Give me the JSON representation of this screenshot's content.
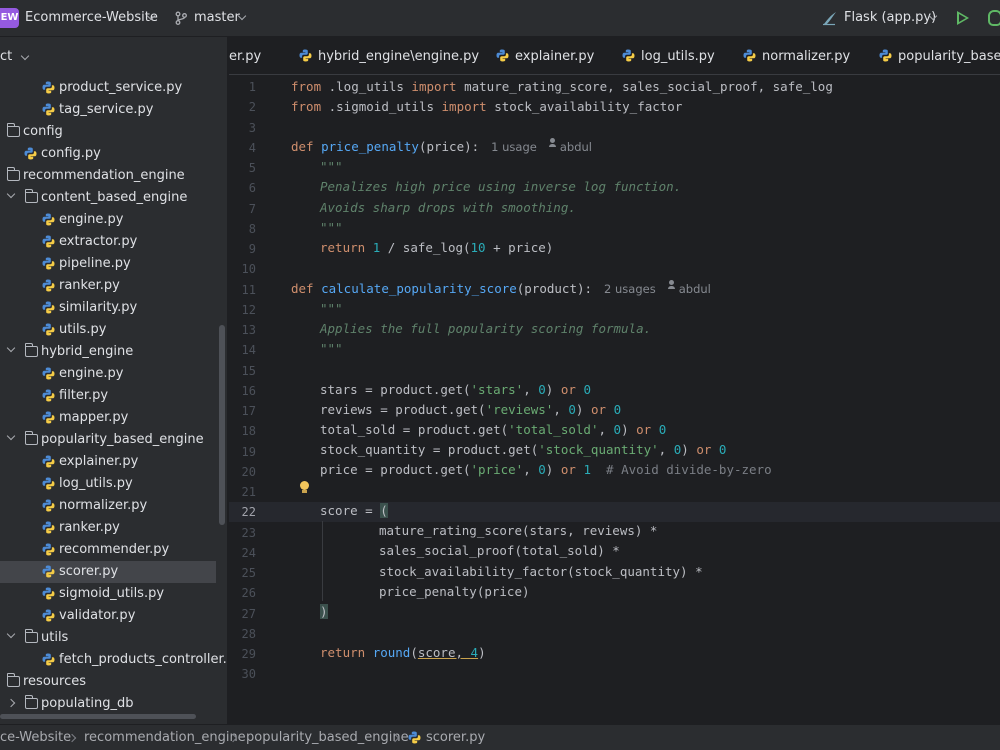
{
  "topbar": {
    "project_badge": "EW",
    "project_name": "Ecommerce-Website",
    "branch": "master",
    "run_config": "Flask (app.py)",
    "colors": {
      "badge": "#955ae0",
      "run": "#5fb865",
      "background": "#2b2d30"
    }
  },
  "project_panel": {
    "header": "ct",
    "tree": [
      {
        "label": "product_service.py",
        "kind": "py"
      },
      {
        "label": "tag_service.py",
        "kind": "py"
      },
      {
        "label": "config",
        "kind": "folder"
      },
      {
        "label": "config.py",
        "kind": "py"
      },
      {
        "label": "recommendation_engine",
        "kind": "folder"
      },
      {
        "label": "content_based_engine",
        "kind": "folder-open"
      },
      {
        "label": "engine.py",
        "kind": "py"
      },
      {
        "label": "extractor.py",
        "kind": "py"
      },
      {
        "label": "pipeline.py",
        "kind": "py"
      },
      {
        "label": "ranker.py",
        "kind": "py"
      },
      {
        "label": "similarity.py",
        "kind": "py"
      },
      {
        "label": "utils.py",
        "kind": "py"
      },
      {
        "label": "hybrid_engine",
        "kind": "folder-open"
      },
      {
        "label": "engine.py",
        "kind": "py"
      },
      {
        "label": "filter.py",
        "kind": "py"
      },
      {
        "label": "mapper.py",
        "kind": "py"
      },
      {
        "label": "popularity_based_engine",
        "kind": "folder-open"
      },
      {
        "label": "explainer.py",
        "kind": "py"
      },
      {
        "label": "log_utils.py",
        "kind": "py"
      },
      {
        "label": "normalizer.py",
        "kind": "py"
      },
      {
        "label": "ranker.py",
        "kind": "py"
      },
      {
        "label": "recommender.py",
        "kind": "py"
      },
      {
        "label": "scorer.py",
        "kind": "py",
        "selected": true
      },
      {
        "label": "sigmoid_utils.py",
        "kind": "py"
      },
      {
        "label": "validator.py",
        "kind": "py"
      },
      {
        "label": "utils",
        "kind": "folder-open"
      },
      {
        "label": "fetch_products_controller.py",
        "kind": "py"
      },
      {
        "label": "resources",
        "kind": "folder"
      },
      {
        "label": "populating_db",
        "kind": "folder-closed"
      }
    ]
  },
  "tabs": [
    {
      "label": "er.py"
    },
    {
      "label": "hybrid_engine\\engine.py"
    },
    {
      "label": "explainer.py"
    },
    {
      "label": "log_utils.py"
    },
    {
      "label": "normalizer.py"
    },
    {
      "label": "popularity_based_"
    }
  ],
  "editor": {
    "line_numbers": [
      "1",
      "2",
      "3",
      "4",
      "5",
      "6",
      "7",
      "8",
      "9",
      "10",
      "11",
      "12",
      "13",
      "14",
      "15",
      "16",
      "17",
      "18",
      "19",
      "20",
      "21",
      "22",
      "23",
      "24",
      "25",
      "26",
      "27",
      "28",
      "29",
      "30"
    ],
    "current_line": "22",
    "hints": {
      "price_penalty_usage": "1 usage",
      "price_penalty_author": "abdul",
      "popularity_usage": "2 usages",
      "popularity_author": "abdul"
    },
    "tokens": {
      "from": "from",
      "import": "import",
      "def": "def",
      "return": "return",
      "or": "or",
      "mod_log_utils": " .log_utils ",
      "imports_1": " mature_rating_score, sales_social_proof, safe_log",
      "mod_sigmoid": " .sigmoid_utils ",
      "imports_2": " stock_availability_factor",
      "fn_price_penalty": "price_penalty",
      "params_price": "(price):",
      "doc_quote": "\"\"\"",
      "doc_6": "Penalizes high price using inverse log function.",
      "doc_7": "Avoids sharp drops with smoothing.",
      "num_1": "1",
      "num_10": "10",
      "num_0": "0",
      "num_4": "4",
      "l9_a": " / safe_log(",
      "l9_b": " + price)",
      "fn_popularity": "calculate_popularity_score",
      "params_product": "(product):",
      "doc_13": "Applies the full popularity scoring formula.",
      "l16_a": "stars = product.get(",
      "str_stars": "'stars'",
      "l17_a": "reviews = product.get(",
      "str_reviews": "'reviews'",
      "l18_a": "total_sold = product.get(",
      "str_total_sold": "'total_sold'",
      "l19_a": "stock_quantity = product.get(",
      "str_stock_quantity": "'stock_quantity'",
      "l20_a": "price = product.get(",
      "str_price": "'price'",
      "comma_sp": ", ",
      "close_sp": ") ",
      "sp": " ",
      "comment_20": "# Avoid divide-by-zero",
      "l22_a": "score = ",
      "open_paren": "(",
      "close_paren": ")",
      "l23": "mature_rating_score(stars, reviews) *",
      "l24": "sales_social_proof(total_sold) *",
      "l25": "stock_availability_factor(stock_quantity) *",
      "l26": "price_penalty(price)",
      "fn_round": "round",
      "l29_a": "score, ",
      "l29_b": ")"
    },
    "colors": {
      "keyword": "#cf8e6d",
      "function": "#56a8f5",
      "string": "#6aab73",
      "number": "#2aacb8",
      "docstring": "#5f826b",
      "comment": "#7a7e85",
      "background": "#1e1f22"
    }
  },
  "statusbar": {
    "breadcrumbs": [
      "ce-Website",
      "recommendation_engine",
      "popularity_based_engine",
      "scorer.py"
    ]
  },
  "icons": [
    "branch-icon",
    "flask-icon",
    "run-icon",
    "debug-icon",
    "folder-icon",
    "python-file-icon",
    "chevron-down-icon",
    "chevron-right-icon",
    "lightbulb-icon",
    "user-icon"
  ]
}
